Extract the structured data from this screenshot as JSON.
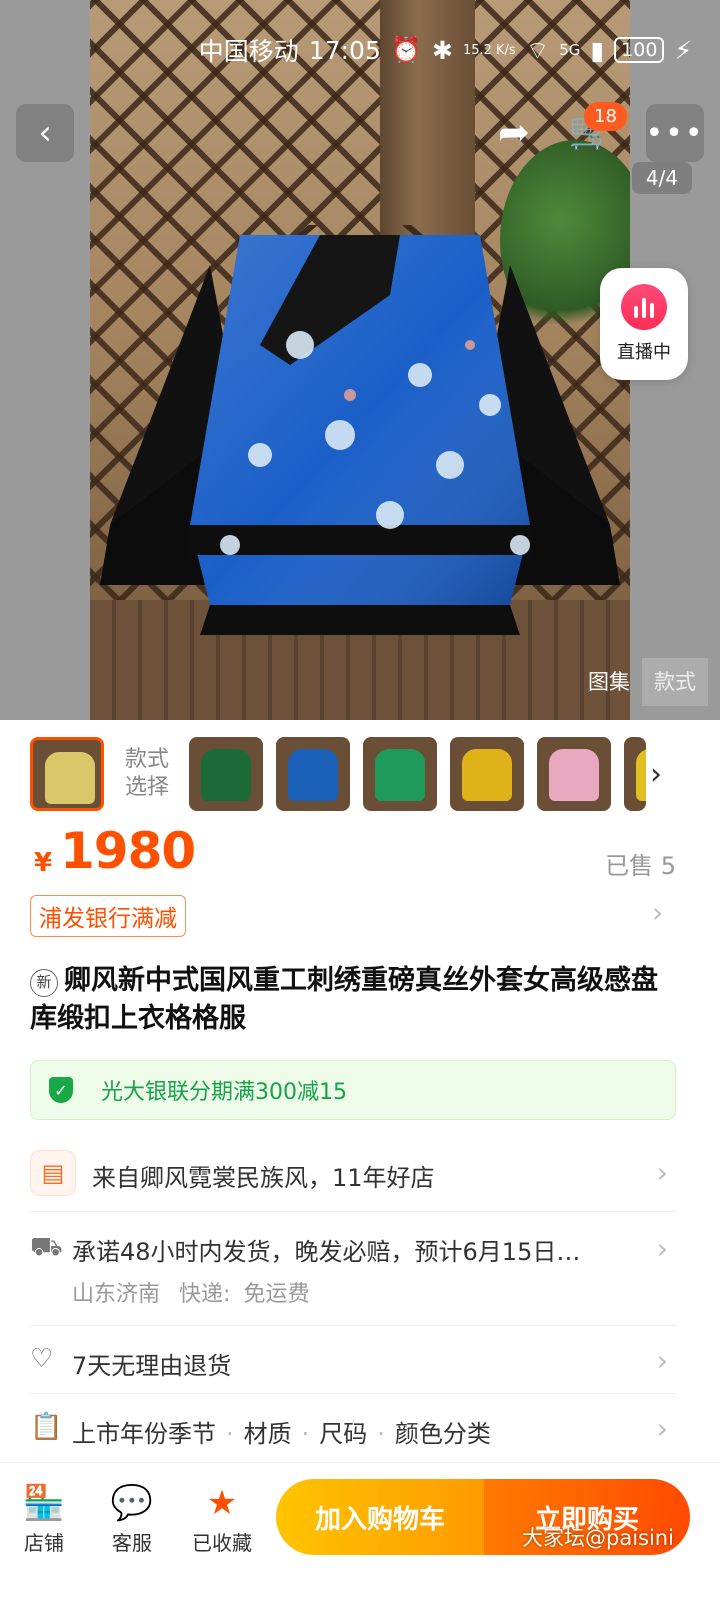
{
  "status_bar": {
    "carrier": "中国移动",
    "time": "17:05",
    "net_speed": "15.2 K/s",
    "network": "5G",
    "battery": "100"
  },
  "gallery": {
    "cart_count": "18",
    "page_indicator": "4/4",
    "live_label": "直播中",
    "tab_gallery": "图集",
    "tab_style": "款式",
    "style_select_label": "款式选择",
    "thumbnail_colors": [
      "#d9c86a",
      "#1e6b3a",
      "#1a5fb8",
      "#1f9a5a",
      "#e0b21a",
      "#e8a8c0",
      "#e0c020"
    ]
  },
  "price": {
    "currency": "¥",
    "amount": "1980",
    "sold": "已售 5",
    "promo_tag": "浦发银行满减"
  },
  "product": {
    "new_badge": "新",
    "title": "卿风新中式国风重工刺绣重磅真丝外套女高级感盘库缎扣上衣格格服"
  },
  "installment": {
    "text": "光大银联分期满300减15"
  },
  "info": {
    "shop": "来自卿风霓裳民族风，11年好店",
    "shipping": "承诺48小时内发货，晚发必赔，预计6月15日…",
    "shipping_origin": "山东济南",
    "shipping_method": "快递:",
    "shipping_fee": "免运费",
    "return_policy": "7天无理由退货",
    "specs": [
      "上市年份季节",
      "材质",
      "尺码",
      "颜色分类"
    ]
  },
  "bottom_bar": {
    "shop": "店铺",
    "service": "客服",
    "favorite": "已收藏",
    "add_to_cart": "加入购物车",
    "buy_now": "立即购买"
  },
  "watermark": "大家坛@paisini"
}
